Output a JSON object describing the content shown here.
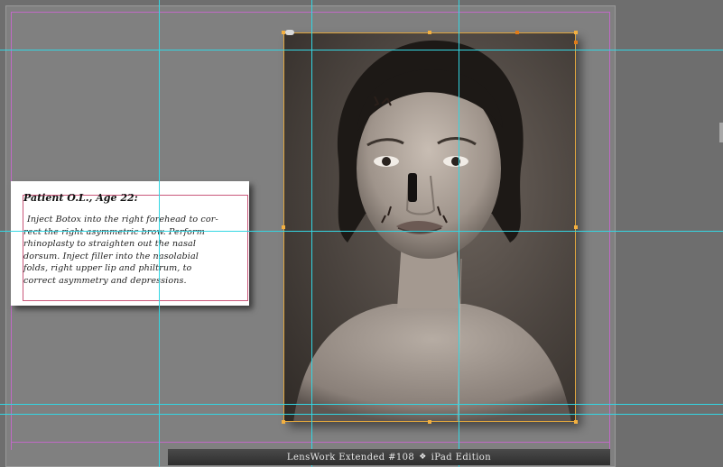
{
  "text_frame": {
    "heading": "Patient O.L., Age 22:",
    "body": "Inject Botox into the right forehead to cor-\nrect the right asymmetric brow. Perform\nrhinoplasty to straighten out the nasal\ndorsum. Inject filler into the nasolabial\nfolds, right upper lip and philtrum, to\ncorrect asymmetry and depressions."
  },
  "footer": {
    "title": "LensWork Extended #108",
    "separator": "❖",
    "edition": "iPad Edition"
  },
  "colors": {
    "guide": "#33d6e3",
    "margin": "#c06ac6",
    "selection": "#e0a63e",
    "pasteboard": "#6e6e6e",
    "page": "#808080"
  }
}
